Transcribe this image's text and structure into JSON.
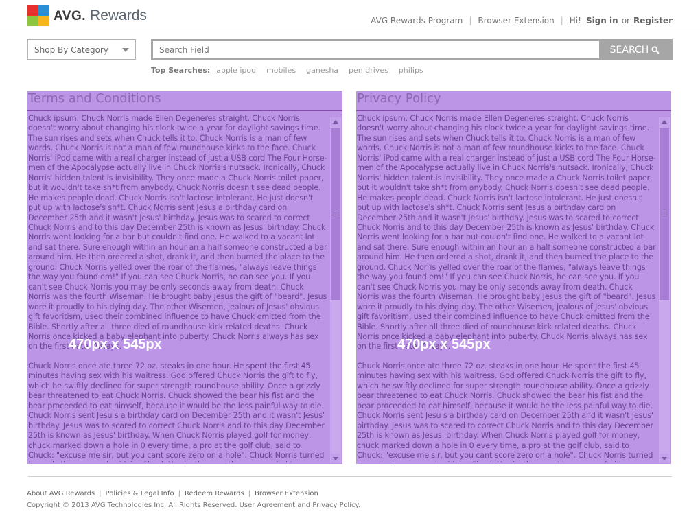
{
  "brand": {
    "avg": "AVG.",
    "rewards": "Rewards",
    "logo_icon": "avg-logo-icon"
  },
  "topnav": {
    "program": "AVG Rewards Program",
    "extension": "Browser Extension",
    "hi": "Hi!",
    "sign_in": "Sign in",
    "or": "or",
    "register": "Register"
  },
  "category": {
    "label": "Shop By Category",
    "icon": "chevron-down-icon"
  },
  "search": {
    "placeholder": "Search Field",
    "button": "SEARCH",
    "icon": "magnifier-icon"
  },
  "top_searches": {
    "label": "Top Searches:",
    "items": [
      "apple ipod",
      "mobiles",
      "ganesha",
      "pen drives",
      "philips"
    ]
  },
  "panels": {
    "terms": {
      "title": "Terms and Conditions",
      "overlay": "470px x 545px",
      "para1": "Chuck ipsum. Chuck Norris made Ellen Degeneres straight. Chuck Norris doesn't worry about changing his clock twice a year for daylight savings time. The sun rises and sets when Chuck tells it to. Chuck Norris is a man of few words. Chuck Norris is not a man of few roundhouse kicks to the face. Chuck Norris' iPod came with a real charger instead of just a USB cord The Four Horse-men of the Apocalypse actually live in Chuck Norris's nutsack. Ironically, Chuck Norris' hidden talent is invisibility. They once made a Chuck Norris toilet paper, but it wouldn't take sh*t from anybody. Chuck Norris doesn't see dead people. He makes people dead. Chuck Norris isn't lactose intolerant. He just doesn't put up with lactose's sh*t. Chuck Norris sent Jesus a birthday card on December 25th and it wasn't Jesus' birthday. Jesus was to scared to correct Chuck Norris and to this day December 25th is known as Jesus' birthday. Chuck Norris went looking for a bar but couldn't find one. He walked to a vacant lot and sat there. Sure enough within an hour an a half someone constructed a bar around him. He then ordered a shot, drank it, and then burned the place to the ground. Chuck Norris yelled over the roar of the flames, \"always leave things the way you found em!\" If you can see Chuck Norris, he can see you. If you can't see Chuck Norris you may be only seconds away from death. Chuck Norris was the fourth Wiseman. He brought baby Jesus the gift of \"beard\". Jesus wore it proudly to his dying day. The other Wisemen, jealous of Jesus' obvious gift favoritism, used their combined influence to have Chuck omitted from the Bible. Shortly after all three died of roundhouse kick related deaths. Chuck Norris once kicked a baby elephant into puberty. Chuck Norris always has sex on the first date. Always.",
      "para2": "Chuck Norris once ate three 72 oz. steaks in one hour. He spent the first 45 minutes having sex with his waitress. God offered Chuck Norris the gift to fly, which he swiftly declined for super strength roundhouse ability. Once a grizzly bear threatened to eat Chuck Norris. Chuck showed the bear his fist and the bear proceeded to eat himself, because it would be the less painful way to die. Chuck Norris sent Jesu s a birthday card on December 25th and it wasn't Jesus' birthday. Jesus was to scared to correct Chuck Norris and to this day December 25th is known as Jesus' birthday. When Chuck Norris played golf for money, chuck marked down a hole in 0 every time, a pro at the golf club, said to Chuck: \"excuse me sir, but you cant score zero on a hole\". Chuck Norris turned towards the man and said, im Chuck Norris, the man then proceeded to pour gas over his"
    },
    "privacy": {
      "title": "Privacy Policy",
      "overlay": "470px x 545px",
      "para1": "Chuck ipsum. Chuck Norris made Ellen Degeneres straight. Chuck Norris doesn't worry about changing his clock twice a year for daylight savings time. The sun rises and sets when Chuck tells it to. Chuck Norris is a man of few words. Chuck Norris is not a man of few roundhouse kicks to the face. Chuck Norris' iPod came with a real charger instead of just a USB cord The Four Horse-men of the Apocalypse actually live in Chuck Norris's nutsack. Ironically, Chuck Norris' hidden talent is invisibility. They once made a Chuck Norris toilet paper, but it wouldn't take sh*t from anybody. Chuck Norris doesn't see dead people. He makes people dead. Chuck Norris isn't lactose intolerant. He just doesn't put up with lactose's sh*t. Chuck Norris sent Jesus a birthday card on December 25th and it wasn't Jesus' birthday. Jesus was to scared to correct Chuck Norris and to this day December 25th is known as Jesus' birthday. Chuck Norris went looking for a bar but couldn't find one. He walked to a vacant lot and sat there. Sure enough within an hour an a half someone constructed a bar around him. He then ordered a shot, drank it, and then burned the place to the ground. Chuck Norris yelled over the roar of the flames, \"always leave things the way you found em!\" If you can see Chuck Norris, he can see you. If you can't see Chuck Norris you may be only seconds away from death. Chuck Norris was the fourth Wiseman. He brought baby Jesus the gift of \"beard\". Jesus wore it proudly to his dying day. The other Wisemen, jealous of Jesus' obvious gift favoritism, used their combined influence to have Chuck omitted from the Bible. Shortly after all three died of roundhouse kick related deaths. Chuck Norris once kicked a baby elephant into puberty. Chuck Norris always has sex on the first date. Always.",
      "para2": "Chuck Norris once ate three 72 oz. steaks in one hour. He spent the first 45 minutes having sex with his waitress. God offered Chuck Norris the gift to fly, which he swiftly declined for super strength roundhouse ability. Once a grizzly bear threatened to eat Chuck Norris. Chuck showed the bear his fist and the bear proceeded to eat himself, because it would be the less painful way to die. Chuck Norris sent Jesu s a birthday card on December 25th and it wasn't Jesus' birthday. Jesus was to scared to correct Chuck Norris and to this day December 25th is known as Jesus' birthday. When Chuck Norris played golf for money, chuck marked down a hole in 0 every time, a pro at the golf club, said to Chuck: \"excuse me sir, but you cant score zero on a hole\". Chuck Norris turned towards the man and said, im Chuck Norris, the man then proceeded to pour gas over his"
    }
  },
  "footer": {
    "links": [
      "About AVG Rewards",
      "Policies & Legal Info",
      "Redeem Rewards",
      "Browser Extension"
    ],
    "copyright": "Copyright © 2013 AVG Technologies Inc. All Rights Reserved. User Agreement and Privacy Policy."
  },
  "colors": {
    "panel": "#bc95e6",
    "panel_text": "#6b4594",
    "search_border": "#a6a6a6"
  }
}
